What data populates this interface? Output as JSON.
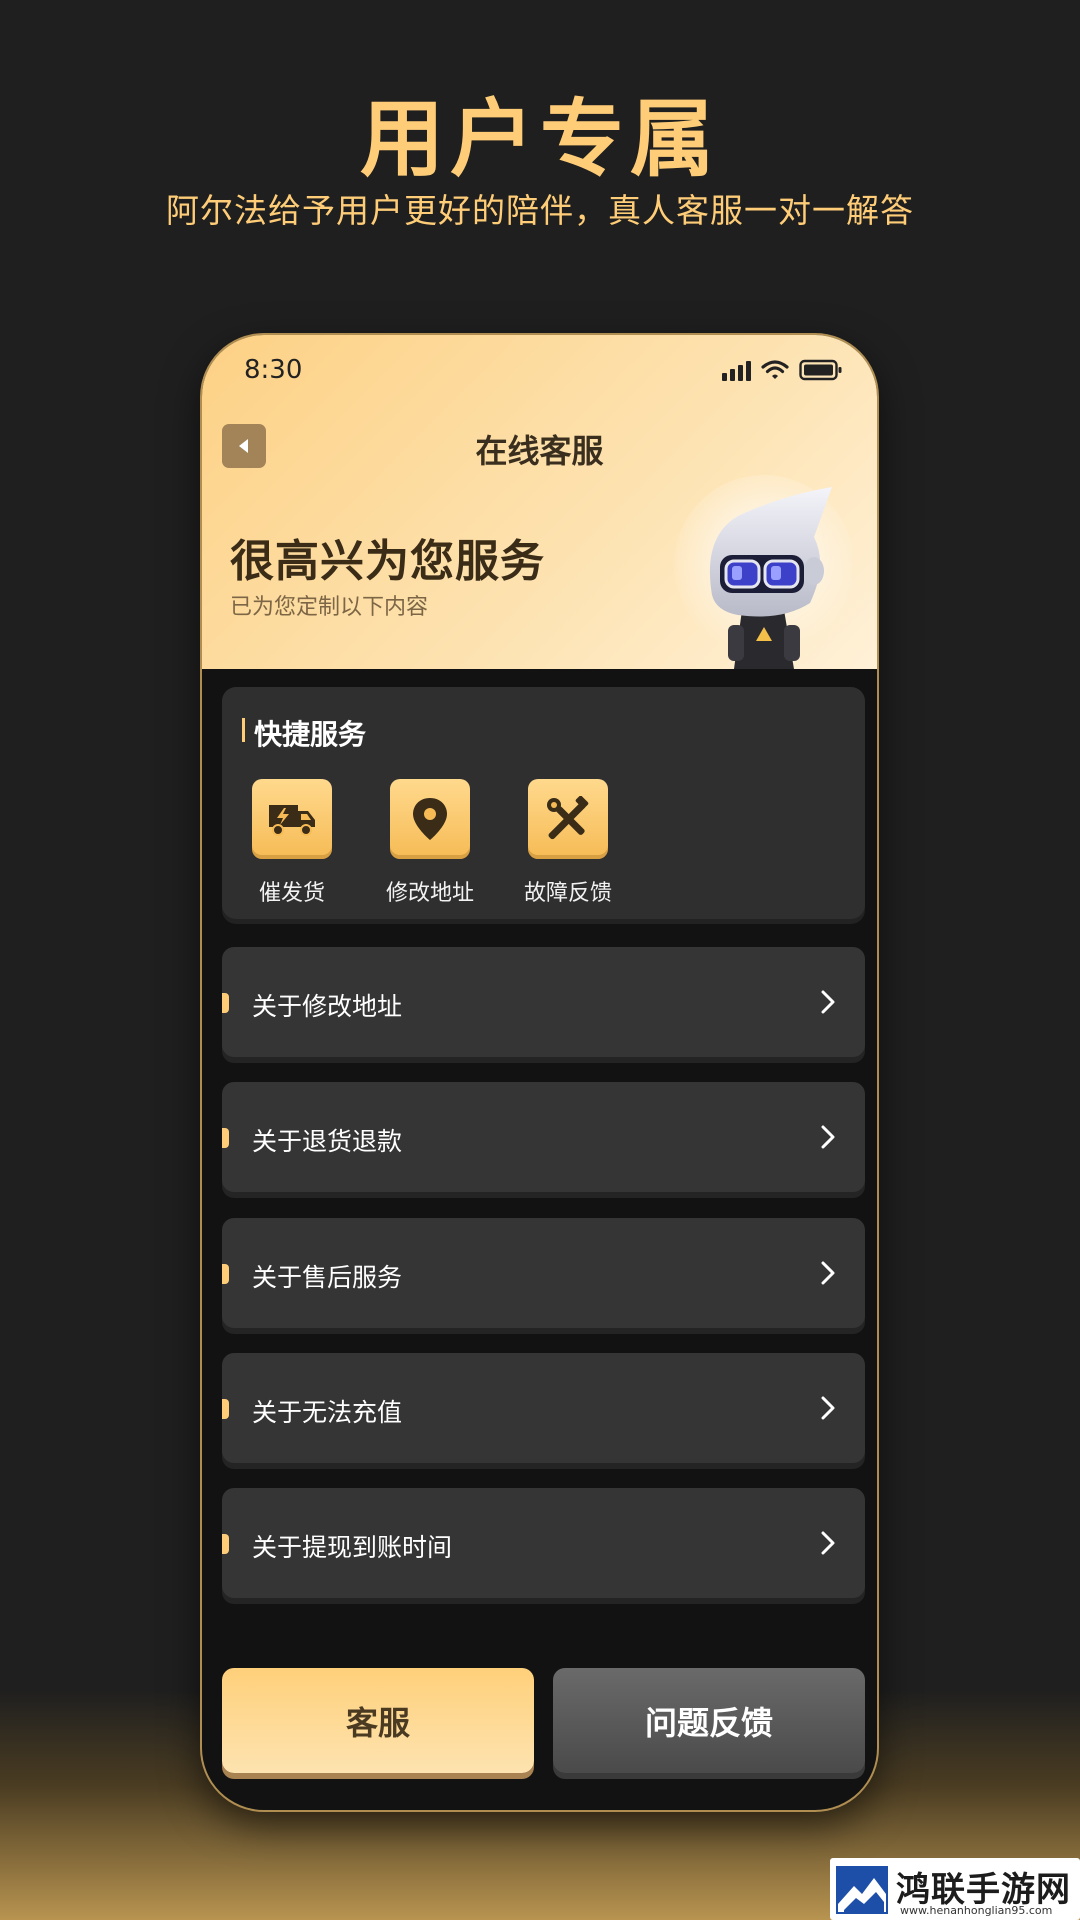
{
  "headline": "用户专属",
  "subline": "阿尔法给予用户更好的陪伴，真人客服一对一解答",
  "status_bar": {
    "time": "8:30"
  },
  "nav": {
    "title": "在线客服"
  },
  "welcome": {
    "title": "很高兴为您服务",
    "subtitle": "已为您定制以下内容"
  },
  "quick_services": {
    "title": "快捷服务",
    "items": [
      {
        "label": "催发货",
        "icon": "delivery-truck-icon"
      },
      {
        "label": "修改地址",
        "icon": "location-pin-icon"
      },
      {
        "label": "故障反馈",
        "icon": "tools-icon"
      }
    ]
  },
  "faq": [
    {
      "label": "关于修改地址"
    },
    {
      "label": "关于退货退款"
    },
    {
      "label": "关于售后服务"
    },
    {
      "label": "关于无法充值"
    },
    {
      "label": "关于提现到账时间"
    }
  ],
  "buttons": {
    "primary": "客服",
    "secondary": "问题反馈"
  },
  "watermark": {
    "name": "鸿联手游网",
    "url": "www.henanhonglian95.com"
  },
  "colors": {
    "accent": "#ffcd78",
    "background": "#1f1f1f",
    "card": "#353535",
    "hero": "#fdd185"
  }
}
